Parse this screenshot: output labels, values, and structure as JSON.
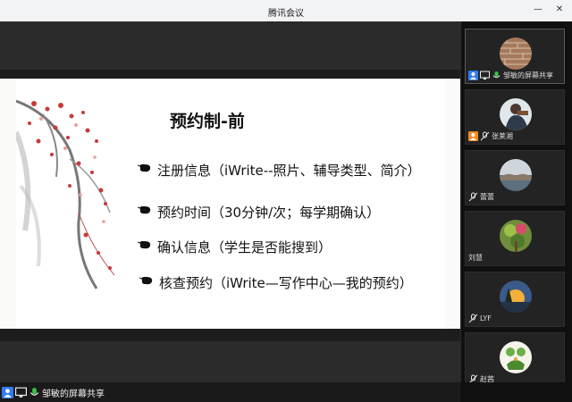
{
  "window": {
    "title": "腾讯会议"
  },
  "slide": {
    "title": "预约制-前",
    "bullets": [
      "注册信息（iWrite--照片、辅导类型、简介）",
      "预约时间（30分钟/次；每学期确认）",
      "确认信息（学生是否能搜到）",
      "核查预约（iWrite—写作中心—我的预约）"
    ]
  },
  "participants": [
    {
      "name": "邹敏的屏幕共享",
      "badges": [
        "user-icon",
        "screen-share-icon",
        "mic-icon"
      ],
      "avatar": "brick-wall-photo"
    },
    {
      "name": "张莱湘",
      "badges": [
        "user-icon",
        "mic-muted-icon"
      ],
      "avatar": "person-photo"
    },
    {
      "name": "蕾蕾",
      "badges": [
        "mic-muted-icon"
      ],
      "avatar": "landscape-photo"
    },
    {
      "name": "刘慧",
      "badges": [],
      "avatar": "plant-photo"
    },
    {
      "name": "LYF",
      "badges": [
        "mic-muted-icon"
      ],
      "avatar": "sunset-photo"
    },
    {
      "name": "赵茜",
      "badges": [
        "mic-muted-icon"
      ],
      "avatar": "cartoon-plant-photo"
    }
  ],
  "bottom_bar": {
    "share_label": "邹敏的屏幕共享"
  },
  "colors": {
    "user_icon": "#2f7cf6",
    "user_icon_orange": "#f08a24",
    "mic_on": "#3bbf4b",
    "mic_muted": "#e9e9e9"
  }
}
